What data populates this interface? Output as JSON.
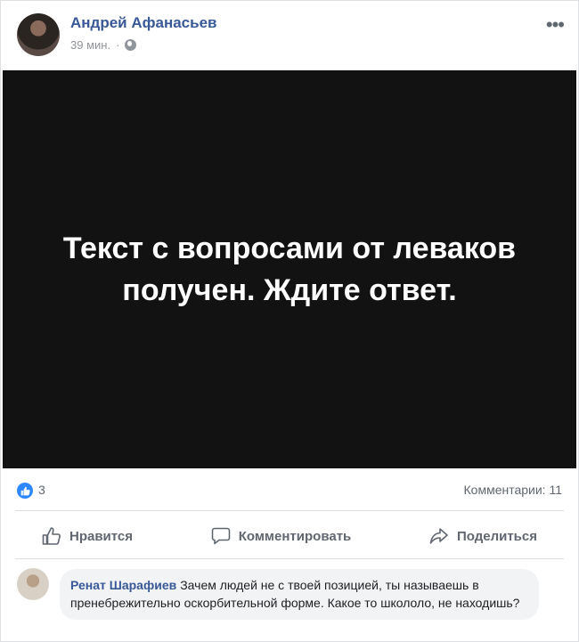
{
  "post": {
    "author": "Андрей Афанасьев",
    "time": "39 мин.",
    "audience_icon": "globe-icon",
    "more_icon": "ellipsis-icon",
    "more_label": "•••",
    "media_text": "Текст с вопросами от леваков получен. Ждите ответ."
  },
  "stats": {
    "like_icon": "thumbs-up-icon",
    "like_count": "3",
    "comments": "Комментарии: 11"
  },
  "actions": {
    "like": "Нравится",
    "comment": "Комментировать",
    "share": "Поделиться"
  },
  "comment": {
    "author": "Ренат Шарафиев",
    "text": "Зачем людей не с твоей позицией, ты называешь в пренебрежительно оскорбительной форме. Какое то школоло, не находишь?"
  },
  "colors": {
    "accent": "#385898",
    "like_badge": "#2d88ff",
    "media_bg": "#121212",
    "bubble_bg": "#f2f3f5"
  }
}
